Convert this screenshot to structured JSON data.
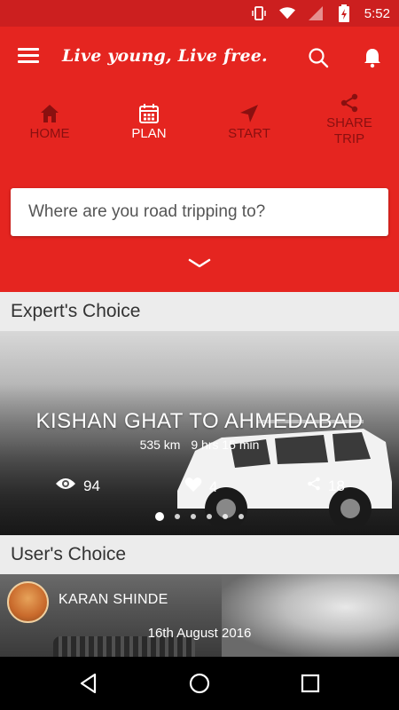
{
  "status_bar": {
    "time": "5:52"
  },
  "header": {
    "brand": "Live young, Live free.",
    "tabs": [
      {
        "label": "HOME",
        "icon": "home-icon",
        "active": false
      },
      {
        "label": "PLAN",
        "icon": "calendar-icon",
        "active": true
      },
      {
        "label": "START",
        "icon": "navigation-arrow-icon",
        "active": false
      },
      {
        "label_line1": "SHARE",
        "label_line2": "TRIP",
        "icon": "share-icon",
        "active": false
      }
    ],
    "search_placeholder": "Where are you road tripping to?"
  },
  "expert_section": {
    "title": "Expert's Choice",
    "card": {
      "route": "KISHAN GHAT TO AHMEDABAD",
      "distance": "535 km",
      "duration": "9 hrs 15 min",
      "views": "94",
      "likes": "4",
      "shares": "18"
    },
    "carousel": {
      "count": 6,
      "active_index": 0
    }
  },
  "user_section": {
    "title": "User's Choice",
    "card": {
      "user_name": "KARAN SHINDE",
      "date": "16th August 2016"
    }
  },
  "colors": {
    "primary_red": "#e52520",
    "status_bar_red": "#cc1f1f",
    "inactive_tab": "#8a1010"
  }
}
